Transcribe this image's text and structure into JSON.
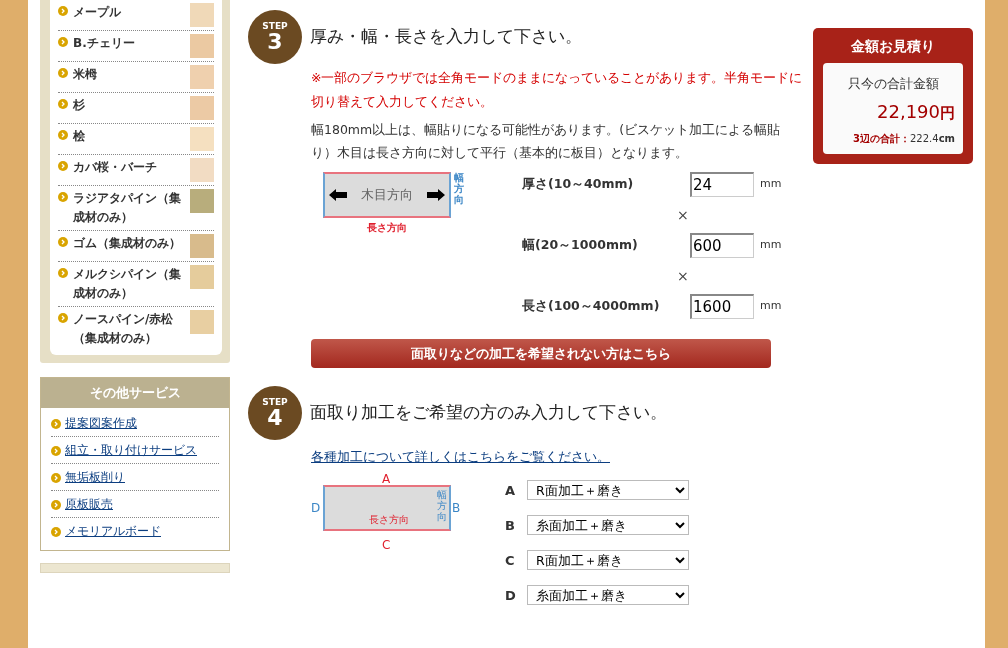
{
  "sidebar": {
    "wood_items": [
      {
        "label": "メープル",
        "color": "#f0d9b8"
      },
      {
        "label": "B.チェリー",
        "color": "#ebc9a2"
      },
      {
        "label": "米栂",
        "color": "#efd0ae"
      },
      {
        "label": "杉",
        "color": "#eccaa5"
      },
      {
        "label": "桧",
        "color": "#f5e0c0"
      },
      {
        "label": "カバ桜・バーチ",
        "color": "#f2dcc3"
      },
      {
        "label": "ラジアタパイン（集成材のみ）",
        "color": "#b8ad7c"
      },
      {
        "label": "ゴム（集成材のみ）",
        "color": "#d8bb8c"
      },
      {
        "label": "メルクシパイン（集成材のみ）",
        "color": "#e5cc9c"
      },
      {
        "label": "ノースパイン/赤松（集成材のみ）",
        "color": "#e8cfa2"
      }
    ],
    "services": {
      "title": "その他サービス",
      "links": [
        "提案図案作成",
        "組立・取り付けサービス",
        "無垢板削り",
        "原板販売",
        "メモリアルボード"
      ]
    }
  },
  "step3": {
    "step_label": "STEP",
    "number": "3",
    "title": "厚み・幅・長さを入力して下さい。",
    "warning": "※一部のブラウザでは全角モードのままになっていることがあります。半角モードに切り替えて入力してください。",
    "note": "幅180mm以上は、幅貼りになる可能性があります。(ビスケット加工による幅貼り）木目は長さ方向に対して平行（基本的に板目）となります。",
    "diagram": {
      "grain": "木目方向",
      "width_dir": "幅方向",
      "length_dir": "長さ方向"
    },
    "fields": [
      {
        "label": "厚さ(10～40mm)",
        "value": "24",
        "unit": "mm"
      },
      {
        "label": "幅(20～1000mm)",
        "value": "600",
        "unit": "mm"
      },
      {
        "label": "長さ(100～4000mm)",
        "value": "1600",
        "unit": "mm"
      }
    ],
    "multipliers": [
      "×",
      "×"
    ],
    "button": "面取りなどの加工を希望されない方はこちら"
  },
  "step4": {
    "step_label": "STEP",
    "number": "4",
    "title": "面取り加工をご希望の方のみ入力して下さい。",
    "link": "各種加工について詳しくはこちらをご覧ください。",
    "diagram": {
      "top": "A",
      "right": "B",
      "bottom": "C",
      "left": "D",
      "width_dir": "幅方向",
      "length_dir": "長さ方向"
    },
    "selects": [
      {
        "letter": "A",
        "value": "R面加工＋磨き"
      },
      {
        "letter": "B",
        "value": "糸面加工＋磨き"
      },
      {
        "letter": "C",
        "value": "R面加工＋磨き"
      },
      {
        "letter": "D",
        "value": "糸面加工＋磨き"
      }
    ]
  },
  "estimate": {
    "title": "金額お見積り",
    "subtitle": "只今の合計金額",
    "amount": "22,190",
    "currency": "円",
    "sides_label": "3辺の合計：",
    "sides_value": "222.4",
    "sides_unit": "cm"
  }
}
